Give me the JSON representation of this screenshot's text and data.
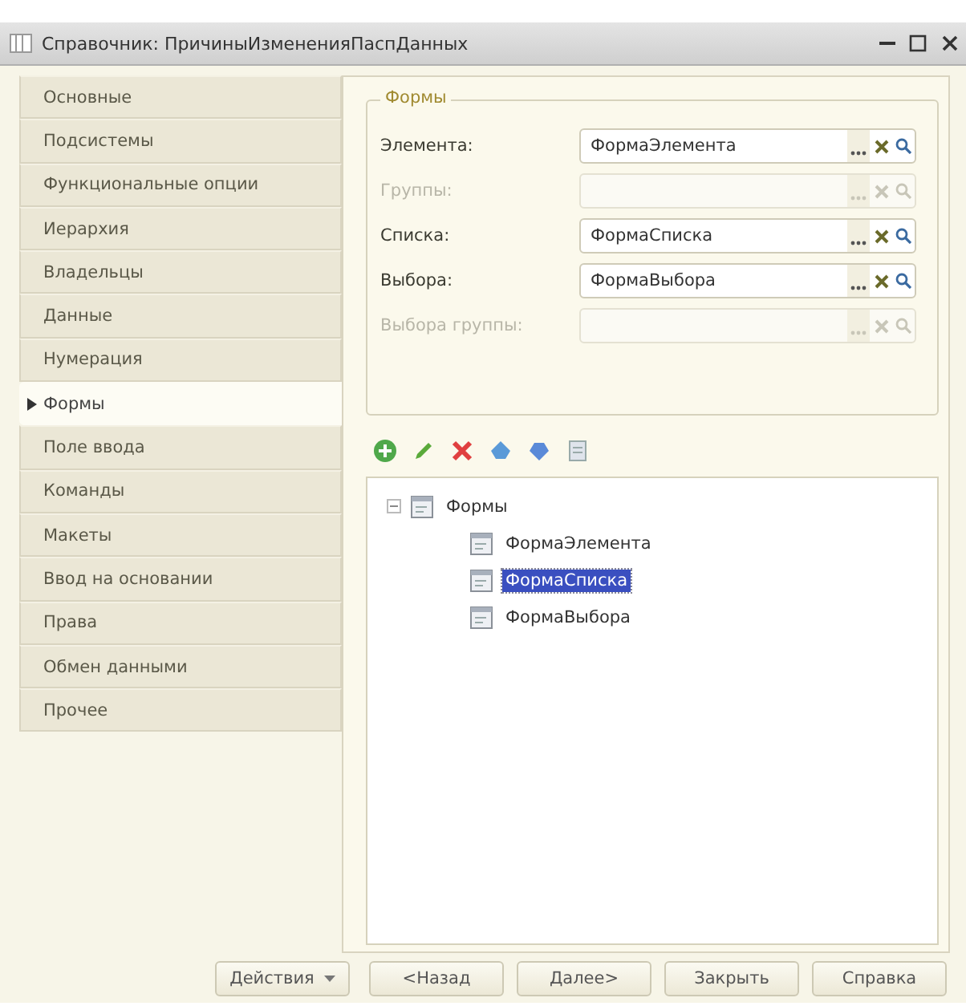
{
  "window": {
    "title": "Справочник: ПричиныИзмененияПаспДанных"
  },
  "sidebar": {
    "items": [
      {
        "label": "Основные",
        "selected": false
      },
      {
        "label": "Подсистемы",
        "selected": false
      },
      {
        "label": "Функциональные опции",
        "selected": false
      },
      {
        "label": "Иерархия",
        "selected": false
      },
      {
        "label": "Владельцы",
        "selected": false
      },
      {
        "label": "Данные",
        "selected": false
      },
      {
        "label": "Нумерация",
        "selected": false
      },
      {
        "label": "Формы",
        "selected": true
      },
      {
        "label": "Поле ввода",
        "selected": false
      },
      {
        "label": "Команды",
        "selected": false
      },
      {
        "label": "Макеты",
        "selected": false
      },
      {
        "label": "Ввод на основании",
        "selected": false
      },
      {
        "label": "Права",
        "selected": false
      },
      {
        "label": "Обмен данными",
        "selected": false
      },
      {
        "label": "Прочее",
        "selected": false
      }
    ]
  },
  "forms_group": {
    "title": "Формы",
    "fields": [
      {
        "label": "Элемента:",
        "value": "ФормаЭлемента",
        "disabled": false
      },
      {
        "label": "Группы:",
        "disabled": true
      },
      {
        "label": "Списка:",
        "value": "ФормаСписка",
        "disabled": false
      },
      {
        "label": "Выбора:",
        "value": "ФормаВыбора",
        "disabled": false
      },
      {
        "label": "Выбора группы:",
        "disabled": true
      }
    ]
  },
  "tree": {
    "items": [
      {
        "label": "Формы",
        "expanded": true,
        "selected": false,
        "children": [
          {
            "label": "ФормаЭлемента",
            "selected": false
          },
          {
            "label": "ФормаСписка",
            "selected": true
          },
          {
            "label": "ФормаВыбора",
            "selected": false
          }
        ]
      }
    ]
  },
  "buttons": [
    {
      "label": "Действия",
      "kind": "menu"
    },
    {
      "label": "<Назад",
      "kind": "plain"
    },
    {
      "label": "Далее>",
      "kind": "plain"
    },
    {
      "label": "Закрыть",
      "kind": "plain"
    },
    {
      "label": "Справка",
      "kind": "plain"
    }
  ]
}
